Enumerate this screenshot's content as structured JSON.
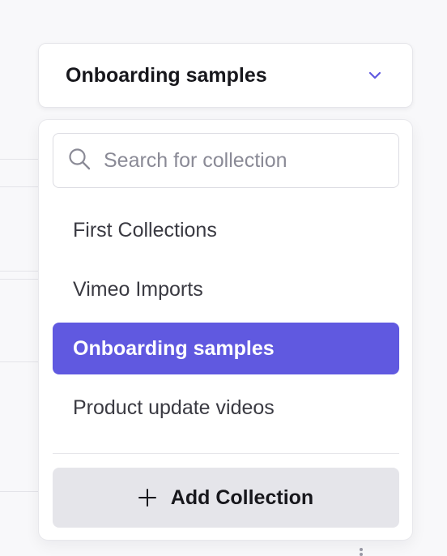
{
  "selector": {
    "value": "Onboarding samples",
    "icon": "chevron-down-icon",
    "accent_color": "#6059e0"
  },
  "dropdown": {
    "search": {
      "placeholder": "Search for collection",
      "value": "",
      "icon": "search-icon"
    },
    "options": [
      {
        "label": "First Collections",
        "selected": false
      },
      {
        "label": "Vimeo Imports",
        "selected": false
      },
      {
        "label": "Onboarding samples",
        "selected": true
      },
      {
        "label": "Product update videos",
        "selected": false
      }
    ],
    "add_button": {
      "label": "Add Collection",
      "icon": "plus-icon"
    }
  }
}
